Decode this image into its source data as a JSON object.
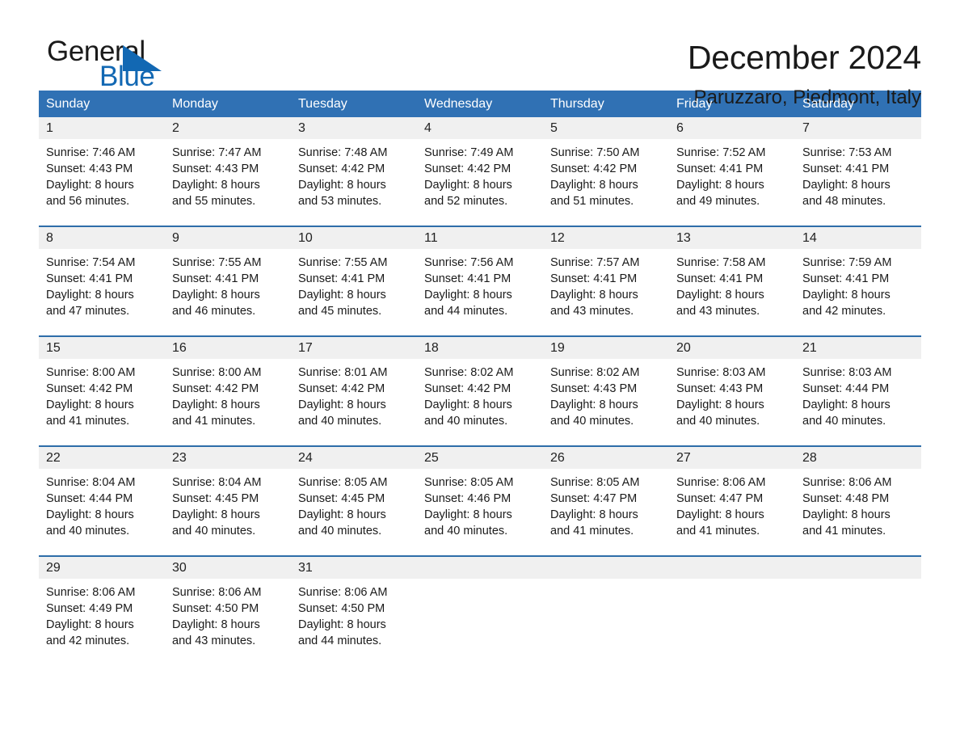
{
  "brand": {
    "name_part1": "General",
    "name_part2": "Blue",
    "triangle_color": "#1268b3"
  },
  "header": {
    "title": "December 2024",
    "location": "Paruzzaro, Piedmont, Italy",
    "accent_color": "#3071b4",
    "weekday_text_color": "#ffffff",
    "daynum_band_color": "#f0f0f0"
  },
  "weekdays": [
    "Sunday",
    "Monday",
    "Tuesday",
    "Wednesday",
    "Thursday",
    "Friday",
    "Saturday"
  ],
  "weeks": [
    [
      {
        "day": "1",
        "sunrise": "Sunrise: 7:46 AM",
        "sunset": "Sunset: 4:43 PM",
        "daylight1": "Daylight: 8 hours",
        "daylight2": "and 56 minutes."
      },
      {
        "day": "2",
        "sunrise": "Sunrise: 7:47 AM",
        "sunset": "Sunset: 4:43 PM",
        "daylight1": "Daylight: 8 hours",
        "daylight2": "and 55 minutes."
      },
      {
        "day": "3",
        "sunrise": "Sunrise: 7:48 AM",
        "sunset": "Sunset: 4:42 PM",
        "daylight1": "Daylight: 8 hours",
        "daylight2": "and 53 minutes."
      },
      {
        "day": "4",
        "sunrise": "Sunrise: 7:49 AM",
        "sunset": "Sunset: 4:42 PM",
        "daylight1": "Daylight: 8 hours",
        "daylight2": "and 52 minutes."
      },
      {
        "day": "5",
        "sunrise": "Sunrise: 7:50 AM",
        "sunset": "Sunset: 4:42 PM",
        "daylight1": "Daylight: 8 hours",
        "daylight2": "and 51 minutes."
      },
      {
        "day": "6",
        "sunrise": "Sunrise: 7:52 AM",
        "sunset": "Sunset: 4:41 PM",
        "daylight1": "Daylight: 8 hours",
        "daylight2": "and 49 minutes."
      },
      {
        "day": "7",
        "sunrise": "Sunrise: 7:53 AM",
        "sunset": "Sunset: 4:41 PM",
        "daylight1": "Daylight: 8 hours",
        "daylight2": "and 48 minutes."
      }
    ],
    [
      {
        "day": "8",
        "sunrise": "Sunrise: 7:54 AM",
        "sunset": "Sunset: 4:41 PM",
        "daylight1": "Daylight: 8 hours",
        "daylight2": "and 47 minutes."
      },
      {
        "day": "9",
        "sunrise": "Sunrise: 7:55 AM",
        "sunset": "Sunset: 4:41 PM",
        "daylight1": "Daylight: 8 hours",
        "daylight2": "and 46 minutes."
      },
      {
        "day": "10",
        "sunrise": "Sunrise: 7:55 AM",
        "sunset": "Sunset: 4:41 PM",
        "daylight1": "Daylight: 8 hours",
        "daylight2": "and 45 minutes."
      },
      {
        "day": "11",
        "sunrise": "Sunrise: 7:56 AM",
        "sunset": "Sunset: 4:41 PM",
        "daylight1": "Daylight: 8 hours",
        "daylight2": "and 44 minutes."
      },
      {
        "day": "12",
        "sunrise": "Sunrise: 7:57 AM",
        "sunset": "Sunset: 4:41 PM",
        "daylight1": "Daylight: 8 hours",
        "daylight2": "and 43 minutes."
      },
      {
        "day": "13",
        "sunrise": "Sunrise: 7:58 AM",
        "sunset": "Sunset: 4:41 PM",
        "daylight1": "Daylight: 8 hours",
        "daylight2": "and 43 minutes."
      },
      {
        "day": "14",
        "sunrise": "Sunrise: 7:59 AM",
        "sunset": "Sunset: 4:41 PM",
        "daylight1": "Daylight: 8 hours",
        "daylight2": "and 42 minutes."
      }
    ],
    [
      {
        "day": "15",
        "sunrise": "Sunrise: 8:00 AM",
        "sunset": "Sunset: 4:42 PM",
        "daylight1": "Daylight: 8 hours",
        "daylight2": "and 41 minutes."
      },
      {
        "day": "16",
        "sunrise": "Sunrise: 8:00 AM",
        "sunset": "Sunset: 4:42 PM",
        "daylight1": "Daylight: 8 hours",
        "daylight2": "and 41 minutes."
      },
      {
        "day": "17",
        "sunrise": "Sunrise: 8:01 AM",
        "sunset": "Sunset: 4:42 PM",
        "daylight1": "Daylight: 8 hours",
        "daylight2": "and 40 minutes."
      },
      {
        "day": "18",
        "sunrise": "Sunrise: 8:02 AM",
        "sunset": "Sunset: 4:42 PM",
        "daylight1": "Daylight: 8 hours",
        "daylight2": "and 40 minutes."
      },
      {
        "day": "19",
        "sunrise": "Sunrise: 8:02 AM",
        "sunset": "Sunset: 4:43 PM",
        "daylight1": "Daylight: 8 hours",
        "daylight2": "and 40 minutes."
      },
      {
        "day": "20",
        "sunrise": "Sunrise: 8:03 AM",
        "sunset": "Sunset: 4:43 PM",
        "daylight1": "Daylight: 8 hours",
        "daylight2": "and 40 minutes."
      },
      {
        "day": "21",
        "sunrise": "Sunrise: 8:03 AM",
        "sunset": "Sunset: 4:44 PM",
        "daylight1": "Daylight: 8 hours",
        "daylight2": "and 40 minutes."
      }
    ],
    [
      {
        "day": "22",
        "sunrise": "Sunrise: 8:04 AM",
        "sunset": "Sunset: 4:44 PM",
        "daylight1": "Daylight: 8 hours",
        "daylight2": "and 40 minutes."
      },
      {
        "day": "23",
        "sunrise": "Sunrise: 8:04 AM",
        "sunset": "Sunset: 4:45 PM",
        "daylight1": "Daylight: 8 hours",
        "daylight2": "and 40 minutes."
      },
      {
        "day": "24",
        "sunrise": "Sunrise: 8:05 AM",
        "sunset": "Sunset: 4:45 PM",
        "daylight1": "Daylight: 8 hours",
        "daylight2": "and 40 minutes."
      },
      {
        "day": "25",
        "sunrise": "Sunrise: 8:05 AM",
        "sunset": "Sunset: 4:46 PM",
        "daylight1": "Daylight: 8 hours",
        "daylight2": "and 40 minutes."
      },
      {
        "day": "26",
        "sunrise": "Sunrise: 8:05 AM",
        "sunset": "Sunset: 4:47 PM",
        "daylight1": "Daylight: 8 hours",
        "daylight2": "and 41 minutes."
      },
      {
        "day": "27",
        "sunrise": "Sunrise: 8:06 AM",
        "sunset": "Sunset: 4:47 PM",
        "daylight1": "Daylight: 8 hours",
        "daylight2": "and 41 minutes."
      },
      {
        "day": "28",
        "sunrise": "Sunrise: 8:06 AM",
        "sunset": "Sunset: 4:48 PM",
        "daylight1": "Daylight: 8 hours",
        "daylight2": "and 41 minutes."
      }
    ],
    [
      {
        "day": "29",
        "sunrise": "Sunrise: 8:06 AM",
        "sunset": "Sunset: 4:49 PM",
        "daylight1": "Daylight: 8 hours",
        "daylight2": "and 42 minutes."
      },
      {
        "day": "30",
        "sunrise": "Sunrise: 8:06 AM",
        "sunset": "Sunset: 4:50 PM",
        "daylight1": "Daylight: 8 hours",
        "daylight2": "and 43 minutes."
      },
      {
        "day": "31",
        "sunrise": "Sunrise: 8:06 AM",
        "sunset": "Sunset: 4:50 PM",
        "daylight1": "Daylight: 8 hours",
        "daylight2": "and 44 minutes."
      },
      {
        "day": "",
        "sunrise": "",
        "sunset": "",
        "daylight1": "",
        "daylight2": ""
      },
      {
        "day": "",
        "sunrise": "",
        "sunset": "",
        "daylight1": "",
        "daylight2": ""
      },
      {
        "day": "",
        "sunrise": "",
        "sunset": "",
        "daylight1": "",
        "daylight2": ""
      },
      {
        "day": "",
        "sunrise": "",
        "sunset": "",
        "daylight1": "",
        "daylight2": ""
      }
    ]
  ]
}
